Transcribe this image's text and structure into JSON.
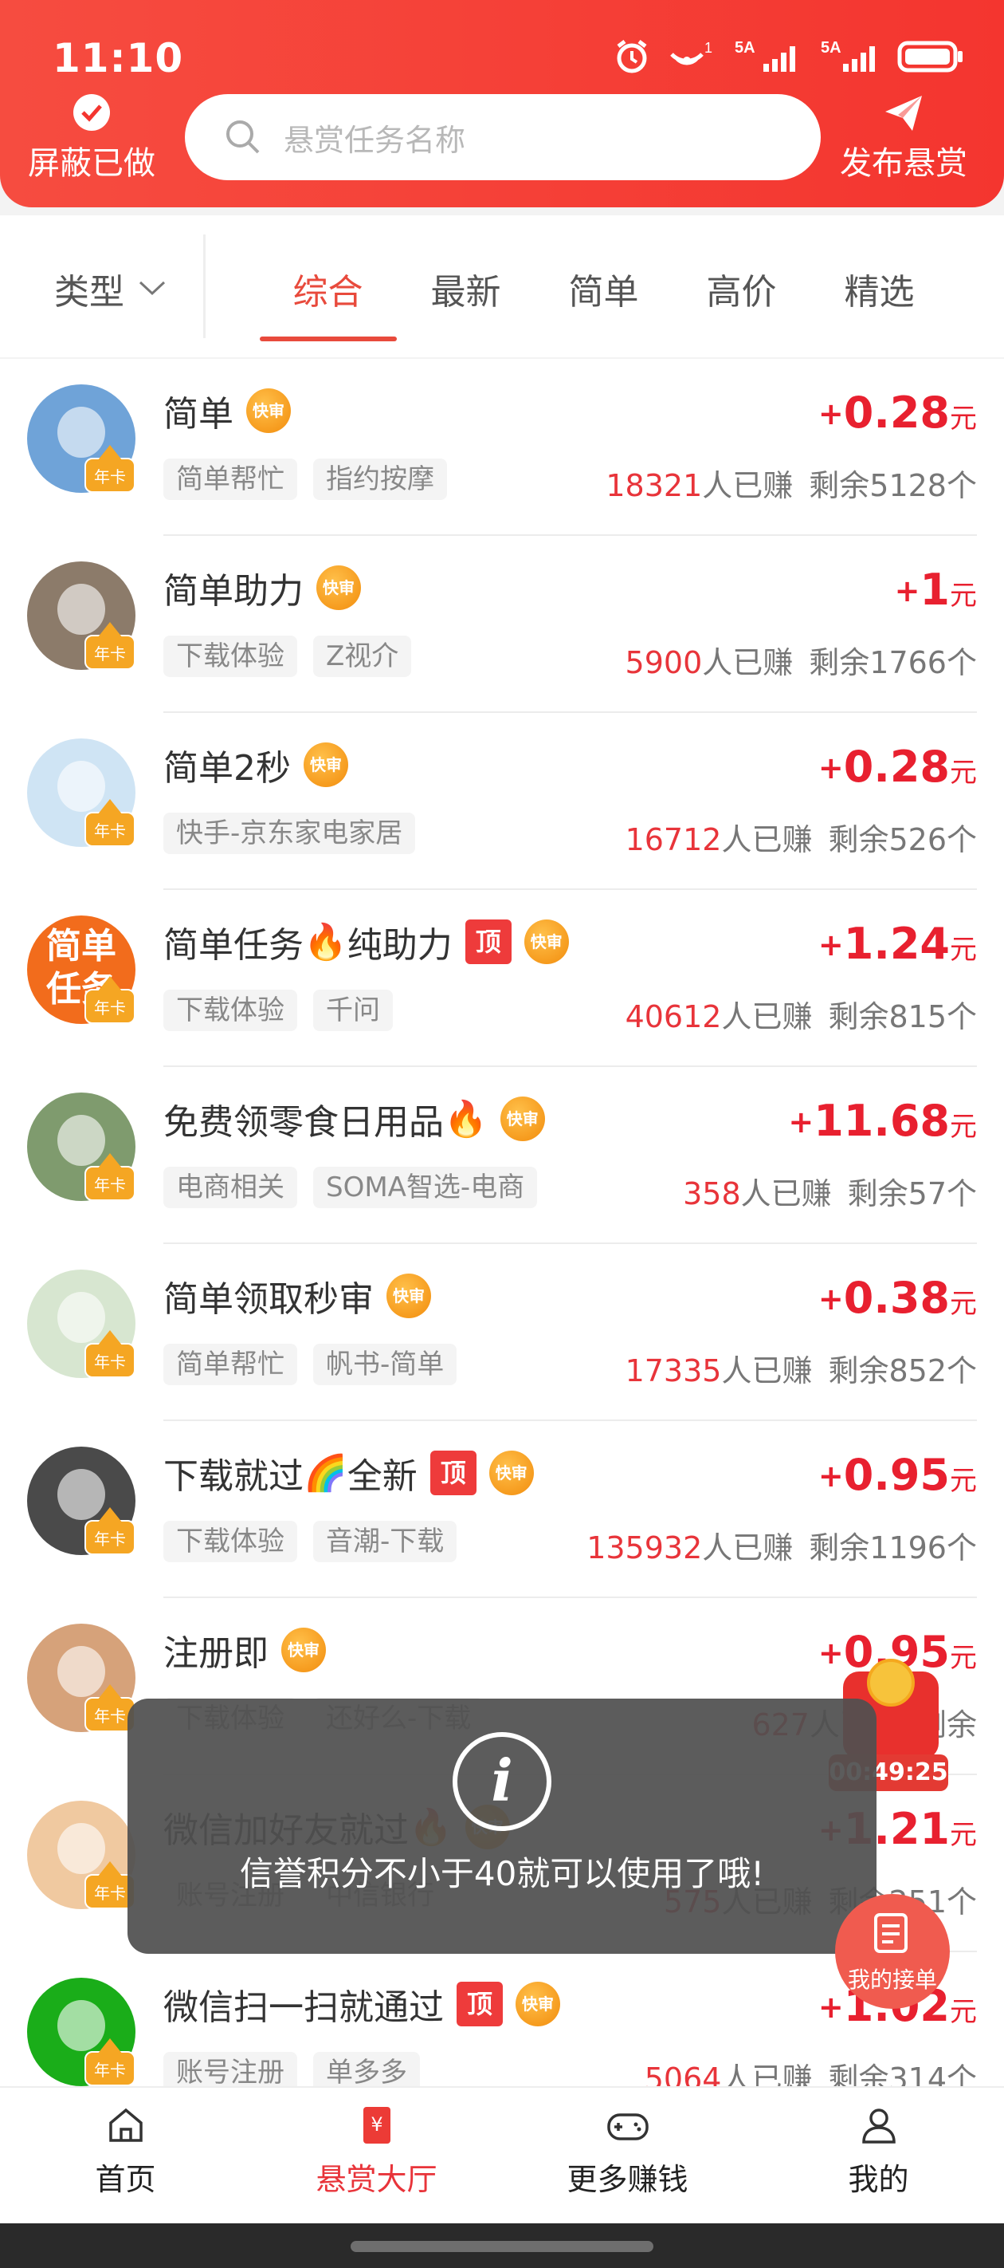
{
  "statusbar": {
    "time": "11:10",
    "signal1_label": "5A",
    "signal2_label": "5A",
    "hotspot_sup": "1"
  },
  "header": {
    "hidden_done_label": "屏蔽已做",
    "search_placeholder": "悬赏任务名称",
    "publish_label": "发布悬赏"
  },
  "filters": {
    "type_label": "类型",
    "tabs": [
      {
        "label": "综合",
        "active": true
      },
      {
        "label": "最新",
        "active": false
      },
      {
        "label": "简单",
        "active": false
      },
      {
        "label": "高价",
        "active": false
      },
      {
        "label": "精选",
        "active": false
      }
    ]
  },
  "badges": {
    "fast": "快审",
    "top": "顶",
    "vip": "年卡"
  },
  "tasks": [
    {
      "title": "简单",
      "emoji": "",
      "title_suffix": "",
      "top": false,
      "tags": [
        "简单帮忙",
        "指约按摩"
      ],
      "reward": "0.28",
      "earned_count": "18321",
      "remaining": "剩余5128个",
      "avatar_color": "#6fa3d8",
      "avatar_text": ""
    },
    {
      "title": "简单助力",
      "emoji": "",
      "title_suffix": "",
      "top": false,
      "tags": [
        "下载体验",
        "Z视介"
      ],
      "reward": "1",
      "earned_count": "5900",
      "remaining": "剩余1766个",
      "avatar_color": "#8c7b6a",
      "avatar_text": ""
    },
    {
      "title": "简单2秒",
      "emoji": "",
      "title_suffix": "",
      "top": false,
      "tags": [
        "快手-京东家电家居"
      ],
      "reward": "0.28",
      "earned_count": "16712",
      "remaining": "剩余526个",
      "avatar_color": "#cfe4f4",
      "avatar_text": ""
    },
    {
      "title": "简单任务",
      "emoji": "🔥",
      "title_suffix": "纯助力",
      "top": true,
      "tags": [
        "下载体验",
        "千问"
      ],
      "reward": "1.24",
      "earned_count": "40612",
      "remaining": "剩余815个",
      "avatar_color": "#f26c1c",
      "avatar_text": "简单\n任务"
    },
    {
      "title": "免费领零食日用品",
      "emoji": "🔥",
      "title_suffix": "",
      "top": false,
      "tags": [
        "电商相关",
        "SOMA智选-电商"
      ],
      "reward": "11.68",
      "earned_count": "358",
      "remaining": "剩余57个",
      "avatar_color": "#7f9b6e",
      "avatar_text": ""
    },
    {
      "title": "简单领取秒审",
      "emoji": "",
      "title_suffix": "",
      "top": false,
      "tags": [
        "简单帮忙",
        "帆书-简单"
      ],
      "reward": "0.38",
      "earned_count": "17335",
      "remaining": "剩余852个",
      "avatar_color": "#d7e6d0",
      "avatar_text": ""
    },
    {
      "title": "下载就过",
      "emoji": "🌈",
      "title_suffix": "全新",
      "top": true,
      "tags": [
        "下载体验",
        "音潮-下载"
      ],
      "reward": "0.95",
      "earned_count": "135932",
      "remaining": "剩余1196个",
      "avatar_color": "#4a4a4a",
      "avatar_text": ""
    },
    {
      "title": "注册即",
      "emoji": "",
      "title_suffix": "",
      "top": false,
      "tags": [
        "下载体验",
        "还好么-下载"
      ],
      "reward": "0.95",
      "earned_count": "627",
      "remaining": "剩余",
      "avatar_color": "#d6a27a",
      "avatar_text": ""
    },
    {
      "title": "微信加好友就过",
      "emoji": "🔥",
      "title_suffix": "",
      "top": false,
      "tags": [
        "账号注册",
        "中信银行"
      ],
      "reward": "1.21",
      "earned_count": "575",
      "remaining": "剩余251个",
      "avatar_color": "#f0c9a0",
      "avatar_text": ""
    },
    {
      "title": "微信扫一扫就通过",
      "emoji": "",
      "title_suffix": "",
      "top": true,
      "tags": [
        "账号注册",
        "单多多"
      ],
      "reward": "1.02",
      "earned_count": "5064",
      "remaining": "剩余314个",
      "avatar_color": "#1aad19",
      "avatar_text": ""
    }
  ],
  "task_labels": {
    "earned_suffix": "人已赚",
    "unit": "元",
    "plus": "+"
  },
  "floating": {
    "redpacket_timer": "00:49:25",
    "my_orders_label": "我的接单"
  },
  "toast": {
    "message": "信誉积分不小于40就可以使用了哦!"
  },
  "bottom_nav": [
    {
      "label": "首页",
      "icon": "home-icon",
      "active": false
    },
    {
      "label": "悬赏大厅",
      "icon": "reward-hall-icon",
      "active": true
    },
    {
      "label": "更多赚钱",
      "icon": "gamepad-icon",
      "active": false
    },
    {
      "label": "我的",
      "icon": "profile-icon",
      "active": false
    }
  ],
  "colors": {
    "brand_red": "#f4352f",
    "price_red": "#e8202f",
    "fast_orange": "#f28c0c"
  }
}
